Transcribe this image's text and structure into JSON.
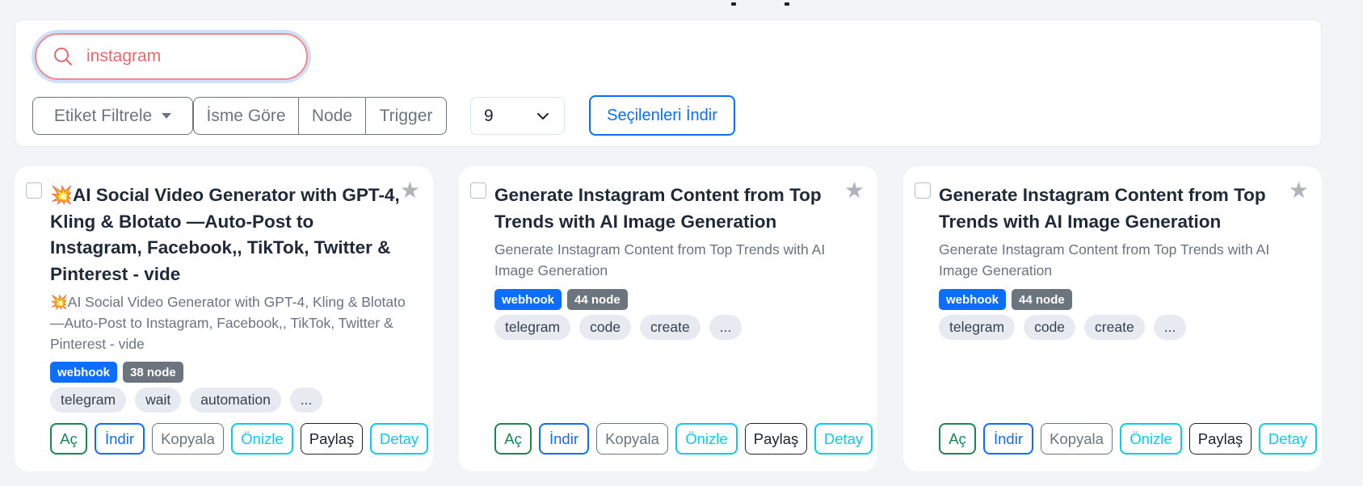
{
  "search": {
    "value": "instagram",
    "placeholder": ""
  },
  "filters": {
    "tag_filter_label": "Etiket Filtrele",
    "sort_options": [
      "İsme Göre",
      "Node",
      "Trigger"
    ],
    "page_size": "9",
    "download_selected_label": "Seçilenleri İndir"
  },
  "colors": {
    "primary": "#0d6efd",
    "success": "#198754",
    "info": "#0dcaf0",
    "secondary": "#6c757d",
    "search_text": "#e46b6b"
  },
  "cards": [
    {
      "title": "💥AI Social Video Generator with GPT-4, Kling & Blotato —Auto-Post to Instagram, Facebook,, TikTok, Twitter & Pinterest - vide",
      "description": "💥AI Social Video Generator with GPT-4, Kling & Blotato —Auto-Post to Instagram, Facebook,, TikTok, Twitter & Pinterest - vide",
      "trigger_badge": "webhook",
      "node_badge": "38 node",
      "tags": [
        "telegram",
        "wait",
        "automation",
        "..."
      ]
    },
    {
      "title": "Generate Instagram Content from Top Trends with AI Image Generation",
      "description": "Generate Instagram Content from Top Trends with AI Image Generation",
      "trigger_badge": "webhook",
      "node_badge": "44 node",
      "tags": [
        "telegram",
        "code",
        "create",
        "..."
      ]
    },
    {
      "title": "Generate Instagram Content from Top Trends with AI Image Generation",
      "description": "Generate Instagram Content from Top Trends with AI Image Generation",
      "trigger_badge": "webhook",
      "node_badge": "44 node",
      "tags": [
        "telegram",
        "code",
        "create",
        "..."
      ]
    }
  ],
  "card_actions": {
    "open": "Aç",
    "download": "İndir",
    "copy": "Kopyala",
    "preview": "Önizle",
    "share": "Paylaş",
    "detail": "Detay"
  },
  "icons": {
    "search": "search-icon",
    "favorite": "star-icon",
    "dropdown": "chevron-down-icon",
    "caret": "caret-down-icon"
  }
}
